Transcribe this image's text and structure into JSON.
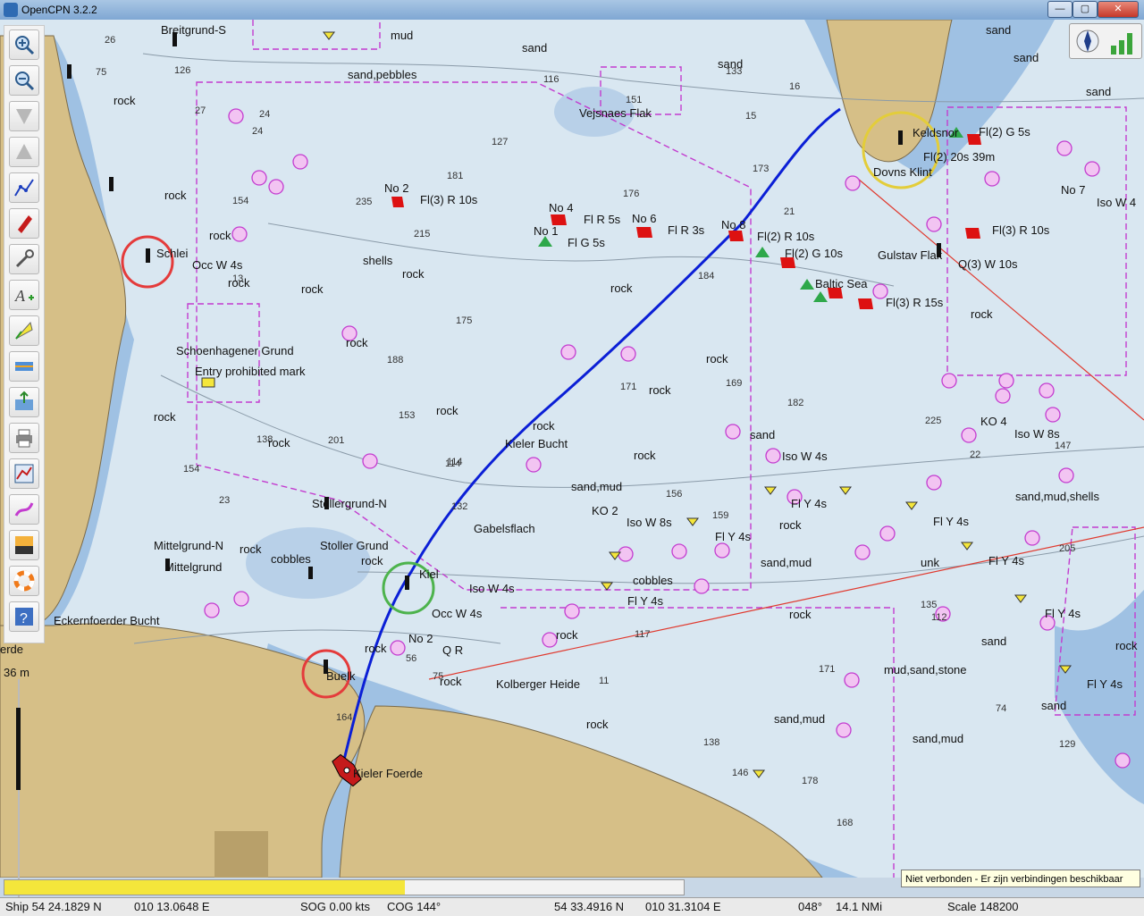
{
  "window": {
    "title": "OpenCPN 3.2.2",
    "controls": {
      "minimize": "—",
      "restore": "▢",
      "close": "✕"
    }
  },
  "toolbar": {
    "items": [
      {
        "name": "zoom-in"
      },
      {
        "name": "zoom-out"
      },
      {
        "name": "scale-down"
      },
      {
        "name": "scale-up"
      },
      {
        "name": "route"
      },
      {
        "name": "auto-follow"
      },
      {
        "name": "options"
      },
      {
        "name": "text-toggle"
      },
      {
        "name": "current-tide"
      },
      {
        "name": "ais"
      },
      {
        "name": "tracks"
      },
      {
        "name": "print"
      },
      {
        "name": "route-manager"
      },
      {
        "name": "track-record"
      },
      {
        "name": "color-scheme"
      },
      {
        "name": "mob"
      },
      {
        "name": "help"
      }
    ]
  },
  "chart": {
    "labels": [
      "Breitgrund-S",
      "mud",
      "sand",
      "sand,pebbles",
      "sand",
      "Vejsnaes Flak",
      "sand",
      "sand",
      "sand",
      "rock",
      "Schlei",
      "Occ W 4s",
      "rock",
      "rock",
      "rock",
      "rock",
      "shells",
      "rock",
      "rock",
      "No 2",
      "Fl(3) R 10s",
      "No 4",
      "Fl R 5s",
      "No 6",
      "Fl R 3s",
      "No 1",
      "Fl G 5s",
      "No 8",
      "Fl(2) R 10s",
      "Fl(2) G 10s",
      "Baltic Sea",
      "Fl(3) R 15s",
      "Gulstav Flak",
      "Q(3) W 10s",
      "Keldsnor",
      "Fl(2) G 5s",
      "Fl(2) 20s 39m",
      "Dovns Klint",
      "No 7",
      "Iso W 4",
      "Fl(3) R 10s",
      "rock",
      "Schoenhagener Grund",
      "Entry prohibited mark",
      "rock",
      "rock",
      "rock",
      "rock",
      "Kieler Bucht",
      "rock",
      "rock",
      "rock",
      "rock",
      "sand",
      "Iso W 4s",
      "KO 4",
      "Iso W 8s",
      "sand,mud",
      "KO 2",
      "Iso W 8s",
      "Fl Y 4s",
      "Fl Y 4s",
      "Fl Y 4s",
      "sand,mud,shells",
      "Fl Y 4s",
      "Fl Y 4s",
      "Stollergrund-N",
      "Stoller Grund",
      "cobbles",
      "Mittelgrund-N",
      "Mittelgrund",
      "rock",
      "rock",
      "Gabelsflach",
      "Kiel",
      "Iso W 4s",
      "Occ W 4s",
      "cobbles",
      "Fl Y 4s",
      "rock",
      "sand,mud",
      "Eckernfoerder Bucht",
      "No 2",
      "Q R",
      "rock",
      "Kolberger Heide",
      "Buelk",
      "unk",
      "rock",
      "sand",
      "mud,sand,stone",
      "Fl Y 4s",
      "sand",
      "sand,mud",
      "sand,mud",
      "rock",
      "Kieler Foerde",
      "rock",
      "rock",
      "rock"
    ],
    "depths": [
      "26",
      "75",
      "126",
      "24",
      "27",
      "24",
      "116",
      "151",
      "133",
      "16",
      "15",
      "127",
      "181",
      "176",
      "173",
      "21",
      "235",
      "215",
      "154",
      "13",
      "184",
      "175",
      "188",
      "153",
      "201",
      "114",
      "138",
      "171",
      "169",
      "182",
      "225",
      "22",
      "205",
      "147",
      "154",
      "23",
      "156",
      "159",
      "164",
      "114",
      "132",
      "117",
      "171",
      "11",
      "74",
      "138",
      "129",
      "168",
      "146",
      "178",
      "56",
      "75",
      "112",
      "135"
    ],
    "side_labels": {
      "left_edge": "erde",
      "left_depth": "36 m"
    }
  },
  "compass": {
    "icon": "north-arrow-icon",
    "signal": "gps-signal-icon"
  },
  "connection_status": "Niet verbonden - Er zijn verbindingen beschikbaar",
  "progress": {
    "fraction": 0.59
  },
  "status": {
    "ship": "Ship 54 24.1829 N",
    "ship_lon": "010 13.0648 E",
    "sog": "SOG 0.00 kts",
    "cog": "COG 144°",
    "cursor_lat": "54 33.4916 N",
    "cursor_lon": "010 31.3104 E",
    "bearing": "048°",
    "distance": "14.1 NMi",
    "scale": "Scale 148200"
  },
  "colors": {
    "land": "#d6bf87",
    "shallow": "#9fc1e3",
    "deep": "#d9e7f1",
    "route": "#0b1fd6",
    "magenta": "#c33ccf",
    "ship": "#c51b1b"
  }
}
